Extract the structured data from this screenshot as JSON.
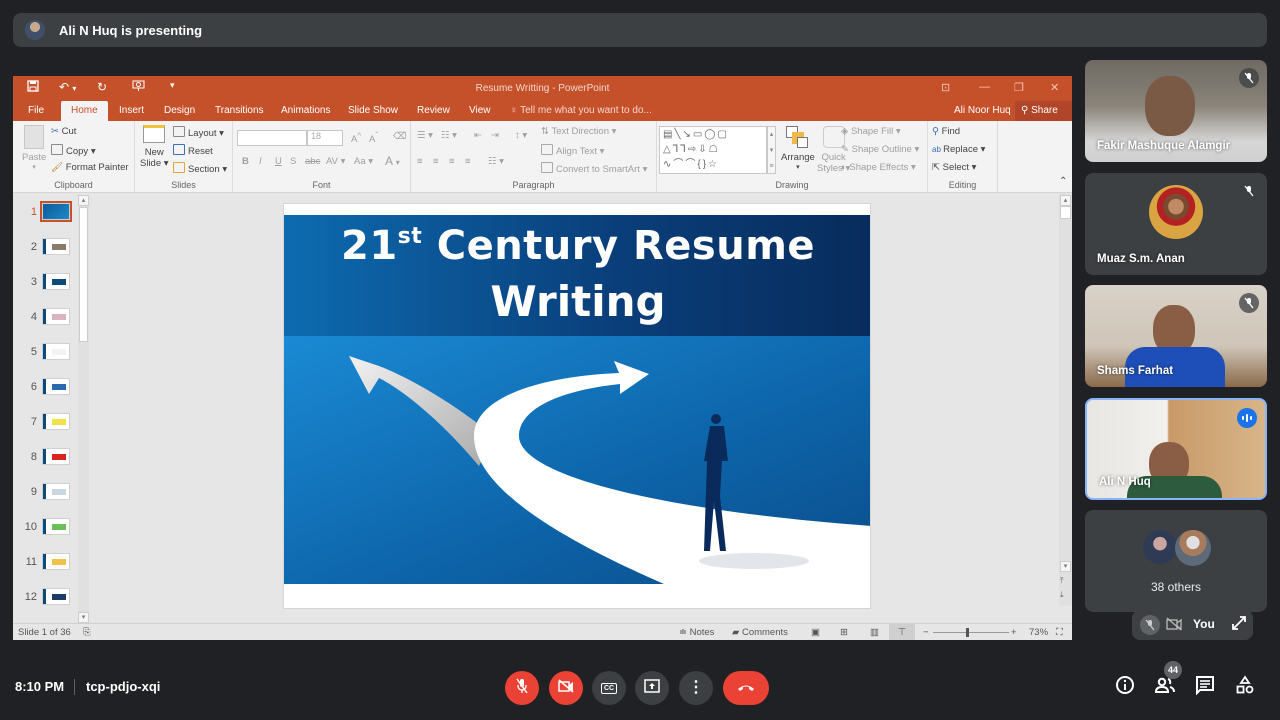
{
  "meet": {
    "presenting_banner": "Ali N Huq is presenting",
    "time": "8:10 PM",
    "meeting_code": "tcp-pdjo-xqi",
    "participant_count": "44",
    "participants": [
      {
        "name": "Fakir Mashuque Alamgir",
        "muted": true,
        "video": true
      },
      {
        "name": "Muaz S.m. Anan",
        "muted": true,
        "video": false
      },
      {
        "name": "Shams Farhat",
        "muted": true,
        "video": true
      },
      {
        "name": "Ali N Huq",
        "muted": false,
        "speaking": true,
        "video": true
      }
    ],
    "others_label": "38 others",
    "self_label": "You",
    "controls": {
      "mic": "mic-off-icon",
      "camera": "camera-off-icon",
      "captions": "captions-icon",
      "present": "present-screen-icon",
      "more": "more-options-icon",
      "leave": "end-call-icon"
    },
    "right_controls": [
      "info-icon",
      "people-icon",
      "chat-icon",
      "activities-icon"
    ],
    "colors": {
      "end_call": "#ea4335",
      "speaking": "#1a73e8",
      "bg": "#202124",
      "tile": "#3c4043"
    }
  },
  "ppt": {
    "window_title": "Resume Writting - PowerPoint",
    "tabs": [
      "File",
      "Home",
      "Insert",
      "Design",
      "Transitions",
      "Animations",
      "Slide Show",
      "Review",
      "View"
    ],
    "active_tab": "Home",
    "tell_me": "Tell me what you want to do...",
    "user": "Ali Noor Huq",
    "share": "Share",
    "accent": "#c5512b",
    "ribbon": {
      "clipboard": {
        "label": "Clipboard",
        "paste": "Paste",
        "cut": "Cut",
        "copy": "Copy",
        "format_painter": "Format Painter"
      },
      "slides": {
        "label": "Slides",
        "new_slide_1": "New",
        "new_slide_2": "Slide",
        "layout": "Layout",
        "reset": "Reset",
        "section": "Section"
      },
      "font": {
        "label": "Font",
        "font_name": "",
        "font_size": "18"
      },
      "paragraph": {
        "label": "Paragraph",
        "text_direction": "Text Direction",
        "align_text": "Align Text",
        "convert": "Convert to SmartArt"
      },
      "drawing": {
        "label": "Drawing",
        "arrange": "Arrange",
        "quick_1": "Quick",
        "quick_2": "Styles",
        "shape_fill": "Shape Fill",
        "shape_outline": "Shape Outline",
        "shape_effects": "Shape Effects"
      },
      "editing": {
        "label": "Editing",
        "find": "Find",
        "replace": "Replace",
        "select": "Select"
      }
    },
    "thumbnails": [
      "1",
      "2",
      "3",
      "4",
      "5",
      "6",
      "7",
      "8",
      "9",
      "10",
      "11",
      "12"
    ],
    "selected_slide": "1",
    "slide": {
      "title_num": "21",
      "title_sup": "st",
      "title_rest": " Century Resume",
      "title_line2": "Writing"
    },
    "status": {
      "slide_info": "Slide 1 of 36",
      "notes": "Notes",
      "comments": "Comments",
      "zoom": "73%",
      "zoom_fraction": 0.43
    }
  }
}
